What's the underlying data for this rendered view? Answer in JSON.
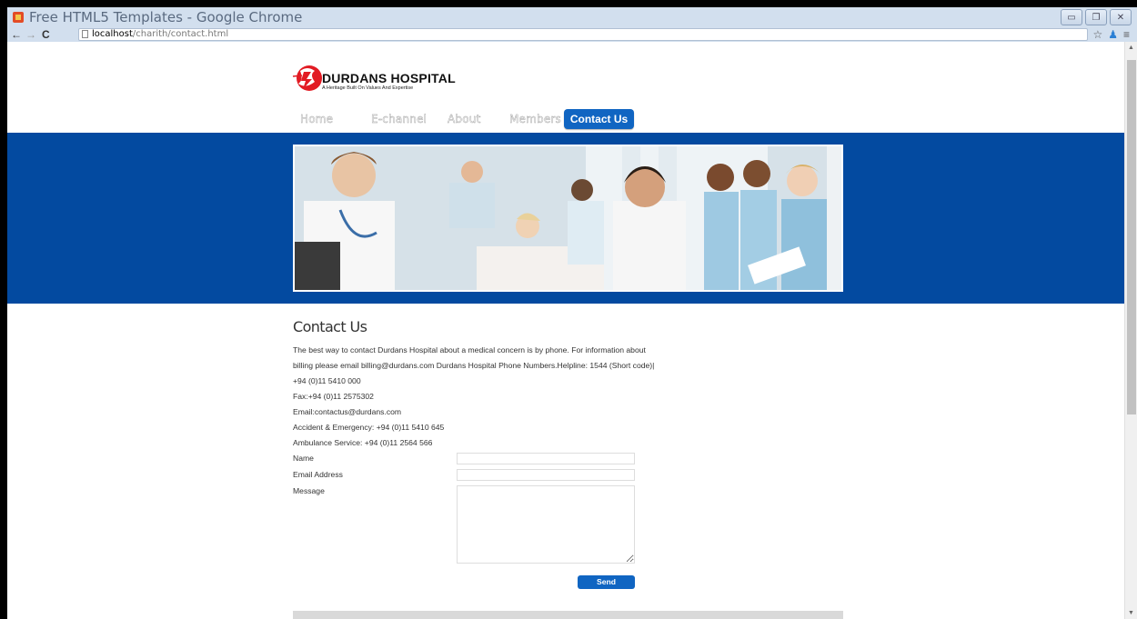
{
  "browser": {
    "window_title": "Free HTML5 Templates - Google Chrome",
    "url_host": "localhost",
    "url_path": "/charith/contact.html"
  },
  "site": {
    "name": "DURDANS HOSPITAL",
    "tagline": "A Heritage Built On Values And Expertise",
    "nav": {
      "home": "Home",
      "echannel": "E-channel",
      "about": "About",
      "members": "Members",
      "contact": "Contact Us"
    }
  },
  "contact": {
    "heading": "Contact Us",
    "lines": [
      "The best way to contact Durdans Hospital about a medical concern is by phone. For information about",
      "billing please email billing@durdans.com Durdans Hospital Phone Numbers.Helpline: 1544 (Short code)|",
      "+94 (0)11 5410 000",
      "Fax:+94 (0)11 2575302",
      "Email:contactus@durdans.com",
      "Accident & Emergency: +94 (0)11 5410 645",
      "Ambulance Service: +94 (0)11 2564 566"
    ],
    "form": {
      "name_label": "Name",
      "email_label": "Email Address",
      "message_label": "Message",
      "send_label": "Send"
    }
  },
  "colors": {
    "banner": "#034aa0",
    "accent": "#1065c2"
  }
}
